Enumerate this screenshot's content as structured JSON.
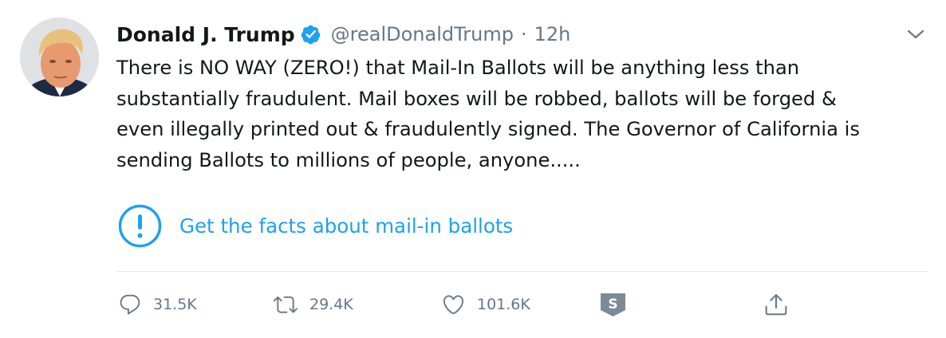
{
  "tweet": {
    "author_name": "Donald J. Trump",
    "handle": "@realDonaldTrump",
    "separator": "·",
    "timestamp": "12h",
    "text_lines": [
      "There is NO WAY (ZERO!) that Mail-In Ballots will be anything less than",
      "substantially fraudulent. Mail boxes will be robbed, ballots will be forged &",
      "even illegally printed out & fraudulently signed. The Governor of California is",
      "sending Ballots to millions of people, anyone....."
    ],
    "fact_check_link": "Get the facts about mail-in ballots"
  },
  "actions": {
    "reply_count": "31.5K",
    "retweet_count": "29.4K",
    "like_count": "101.6K",
    "extension_badge_letter": "S"
  },
  "icons": {
    "verified": "verified-badge-icon",
    "caret": "chevron-down-icon",
    "notice": "exclamation-circle-icon",
    "reply": "reply-icon",
    "retweet": "retweet-icon",
    "like": "heart-icon",
    "extension": "s-badge-icon",
    "share": "share-icon"
  },
  "colors": {
    "accent": "#1da1f2",
    "text": "#14171a",
    "muted": "#657786",
    "divider": "#e1e8ed"
  }
}
